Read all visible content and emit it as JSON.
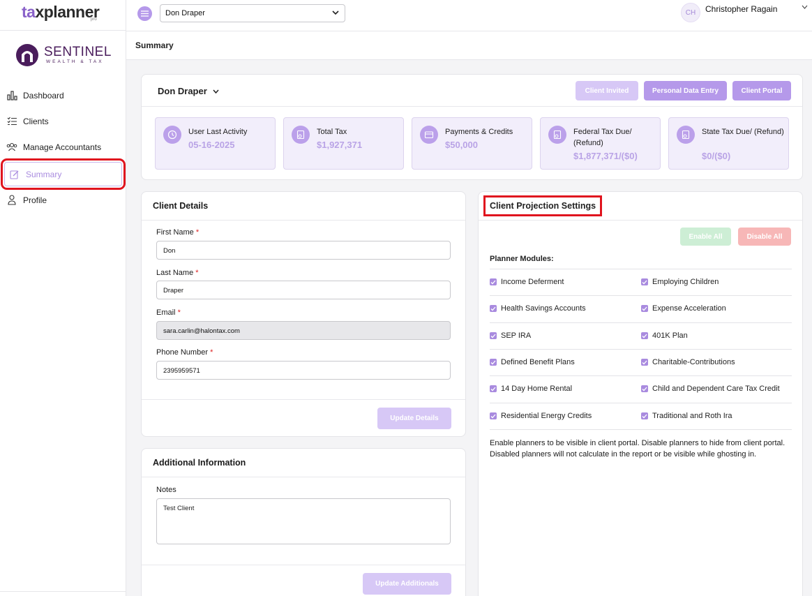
{
  "app": {
    "logo_main": "taxplanner",
    "logo_sub": "pro",
    "brand_name": "SENTINEL",
    "brand_tag": "WEALTH & TAX"
  },
  "sidebar": {
    "items": [
      {
        "label": "Dashboard",
        "icon": "chart-icon"
      },
      {
        "label": "Clients",
        "icon": "list-icon"
      },
      {
        "label": "Manage Accountants",
        "icon": "users-icon"
      },
      {
        "label": "Summary",
        "icon": "edit-icon",
        "active": true
      },
      {
        "label": "Profile",
        "icon": "user-icon"
      }
    ]
  },
  "topbar": {
    "client_selected": "Don Draper",
    "user_initials": "CH",
    "user_name": "Christopher Ragain"
  },
  "page": {
    "title": "Summary"
  },
  "summary": {
    "client_name": "Don Draper",
    "buttons": {
      "invited": "Client Invited",
      "personal": "Personal Data Entry",
      "portal": "Client Portal"
    },
    "stats": [
      {
        "label": "User Last Activity",
        "value": "05-16-2025"
      },
      {
        "label": "Total Tax",
        "value": "$1,927,371"
      },
      {
        "label": "Payments & Credits",
        "value": "$50,000"
      },
      {
        "label": "Federal Tax Due/ (Refund)",
        "value": "$1,877,371/($0)"
      },
      {
        "label": "State Tax Due/ (Refund)",
        "value": "$0/($0)"
      }
    ]
  },
  "client_details": {
    "title": "Client Details",
    "first_name_label": "First Name",
    "first_name": "Don",
    "last_name_label": "Last Name",
    "last_name": "Draper",
    "email_label": "Email",
    "email": "sara.carlin@halontax.com",
    "phone_label": "Phone Number",
    "phone": "2395959571",
    "update_button": "Update Details"
  },
  "additional": {
    "title": "Additional Information",
    "notes_label": "Notes",
    "notes": "Test Client",
    "update_button": "Update Additionals"
  },
  "projection": {
    "title": "Client Projection Settings",
    "enable_all": "Enable All",
    "disable_all": "Disable All",
    "modules_title": "Planner Modules:",
    "modules": [
      [
        "Income Deferment",
        "Employing Children"
      ],
      [
        "Health Savings Accounts",
        "Expense Acceleration"
      ],
      [
        "SEP IRA",
        "401K Plan"
      ],
      [
        "Defined Benefit Plans",
        "Charitable-Contributions"
      ],
      [
        "14 Day Home Rental",
        "Child and Dependent Care Tax Credit"
      ],
      [
        "Residential Energy Credits",
        "Traditional and Roth Ira"
      ]
    ],
    "note": "Enable planners to be visible in client portal. Disable planners to hide from client portal. Disabled planners will not calculate in the report or be visible while ghosting in."
  },
  "colors": {
    "accent": "#b599ea",
    "accent_light": "#d7c8f6",
    "highlight": "#e0141e",
    "enable_btn": "#cdeed5",
    "disable_btn": "#f7b7b7"
  }
}
